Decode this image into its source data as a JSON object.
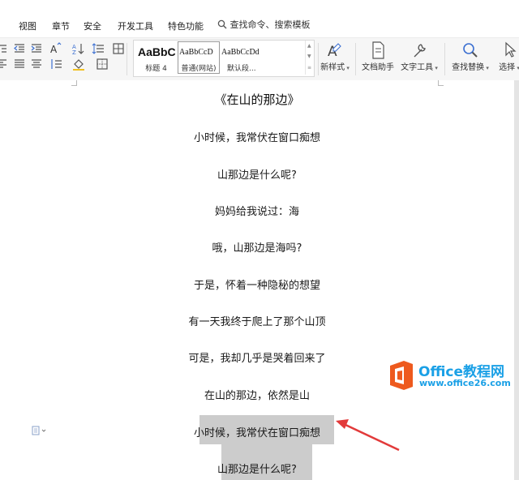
{
  "menu": {
    "items": [
      "视图",
      "章节",
      "安全",
      "开发工具",
      "特色功能"
    ],
    "search_label": "查找命令、搜索模板"
  },
  "ribbon": {
    "styles": [
      {
        "sample": "AaBbC",
        "label": "标题 4"
      },
      {
        "sample": "AaBbCcD",
        "label": "普通(网站)"
      },
      {
        "sample": "AaBbCcDd",
        "label": "默认段..."
      }
    ],
    "buttons": {
      "new_style": "新样式",
      "doc_assistant": "文档助手",
      "text_tools": "文字工具",
      "find_replace": "查找替换",
      "select": "选择"
    }
  },
  "document": {
    "title": "《在山的那边》",
    "lines": [
      "小时候，我常伏在窗口痴想",
      "山那边是什么呢?",
      "妈妈给我说过：海",
      "哦，山那边是海吗?",
      "于是，怀着一种隐秘的想望",
      "有一天我终于爬上了那个山顶",
      "可是，我却几乎是哭着回来了",
      "在山的那边，依然是山",
      "小时候，我常伏在窗口痴想",
      "山那边是什么呢?"
    ]
  },
  "watermark": {
    "brand": "Office教程网",
    "url": "www.office26.com"
  },
  "colors": {
    "highlight": "#cccccc",
    "arrow": "#e23a3a",
    "brand_blue": "#1aa0e6",
    "brand_orange": "#ee5a1e"
  }
}
